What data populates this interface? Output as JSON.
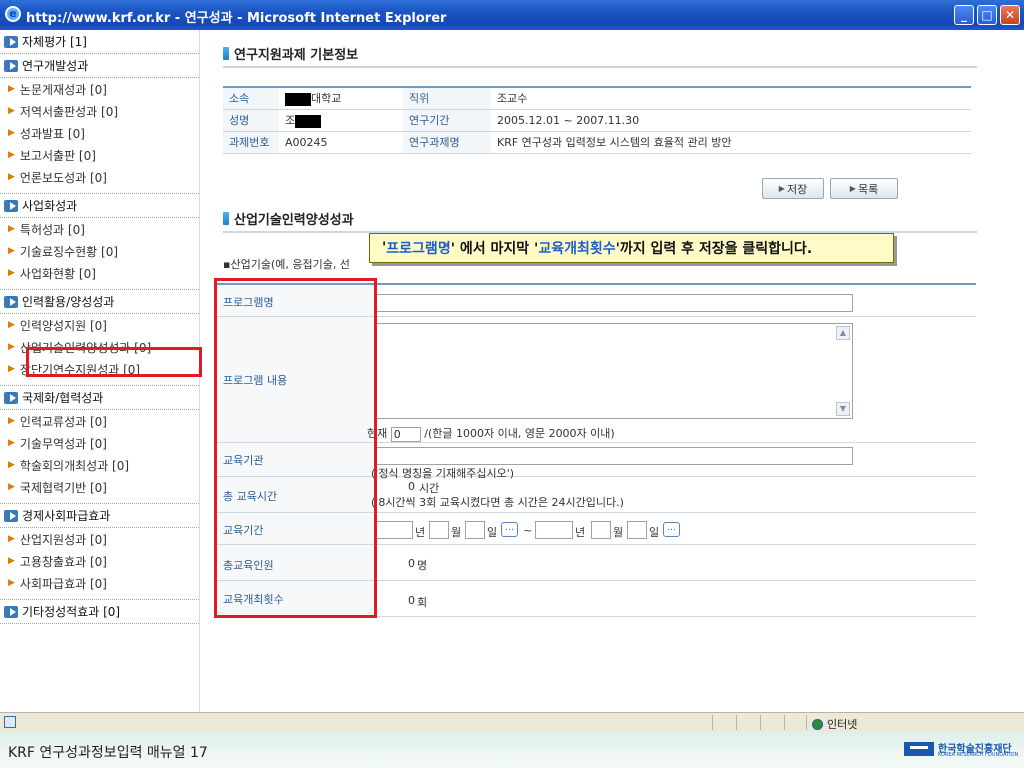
{
  "window": {
    "title": "http://www.krf.or.kr - 연구성과 - Microsoft Internet Explorer",
    "minimize": "_",
    "maximize": "□",
    "close": "✕"
  },
  "sidebar": {
    "top_item": "자체평가 [1]",
    "categories": [
      {
        "label": "연구개발성과",
        "items": [
          "논문게재성과 [0]",
          "저역서출판성과 [0]",
          "성과발표 [0]",
          "보고서출판 [0]",
          "언론보도성과 [0]"
        ]
      },
      {
        "label": "사업화성과",
        "items": [
          "특허성과 [0]",
          "기술료징수현황 [0]",
          "사업화현황 [0]"
        ]
      },
      {
        "label": "인력활용/양성성과",
        "items": [
          "인력양성지원 [0]",
          "산업기술인력양성성과 [0]",
          "장단기연수지원성과 [0]"
        ]
      },
      {
        "label": "국제화/협력성과",
        "items": [
          "인력교류성과 [0]",
          "기술무역성과 [0]",
          "학술회의개최성과 [0]",
          "국제협력기반 [0]"
        ]
      },
      {
        "label": "경제사회파급효과",
        "items": [
          "산업지원성과 [0]",
          "고용창출효과 [0]",
          "사회파급효과 [0]"
        ]
      },
      {
        "label": "기타정성적효과 [0]",
        "items": []
      }
    ]
  },
  "basic_info": {
    "title": "연구지원과제 기본정보",
    "rows": [
      {
        "l1": "소속",
        "v1": "대학교",
        "l2": "직위",
        "v2": "조교수"
      },
      {
        "l1": "성명",
        "v1": "조",
        "l2": "연구기간",
        "v2": "2005.12.01 ~ 2007.11.30"
      },
      {
        "l1": "과제번호",
        "v1": "A00245",
        "l2": "연구과제명",
        "v2": "KRF 연구성과 입력정보 시스템의 효율적 관리 방안"
      }
    ],
    "save_label": "저장",
    "list_label": "목록"
  },
  "industry": {
    "title": "산업기술인력양성성과",
    "desc": "▪산업기술(예, 응접기술, 선",
    "callout_pre": "'",
    "callout_hl1": "프로그램명",
    "callout_mid": "' 에서 마지막 '",
    "callout_hl2": "교육개최횟수",
    "callout_post": "'까지 입력 후 저장을 클릭합니다.",
    "labels": {
      "program_name": "프로그램명",
      "program_content": "프로그램 내용",
      "institution": "교육기관",
      "total_hours": "총 교육시간",
      "period": "교육기간",
      "total_people": "총교육인원",
      "sessions": "교육개최횟수"
    },
    "char_count_prefix": "현재",
    "char_count_value": "0",
    "char_count_suffix": "/(한글 1000자 이내, 영문 2000자 이내)",
    "institution_hint": "('정식 명칭을 기재해주십시오')",
    "hours_value": "0",
    "hours_unit": "시간",
    "hours_hint": "('8시간씩 3회 교육시켰다면 총 시간은 24시간입니다.)",
    "year_unit": "년",
    "month_unit": "월",
    "day_unit": "일",
    "tilde": "~",
    "people_value": "0",
    "people_unit": "명",
    "sessions_value": "0",
    "sessions_unit": "회"
  },
  "statusbar": {
    "zone": "인터넷"
  },
  "footer": {
    "text": "KRF 연구성과정보입력 매뉴얼 17",
    "logo_name": "한국학술진흥재단",
    "logo_sub": "KOREA RESEARCH FOUNDATION"
  },
  "colors": {
    "accent": "#2b5f97",
    "highlight": "#e01b24",
    "callout_bg": "#fffbc6"
  }
}
